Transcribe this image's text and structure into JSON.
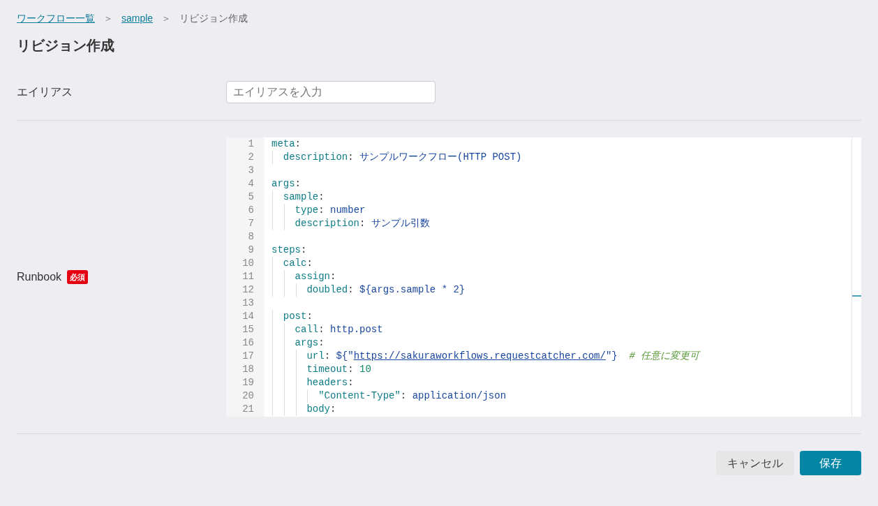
{
  "breadcrumb": [
    {
      "label": "ワークフロー一覧",
      "kind": "link"
    },
    {
      "label": "＞",
      "kind": "separator"
    },
    {
      "label": "sample",
      "kind": "link"
    },
    {
      "label": "＞",
      "kind": "separator"
    },
    {
      "label": "リビジョン作成",
      "kind": "current"
    }
  ],
  "title": "リビジョン作成",
  "alias": {
    "label": "エイリアス",
    "placeholder": "エイリアスを入力"
  },
  "runbook": {
    "label": "Runbook",
    "required_badge": "必須",
    "lines": [
      {
        "number": "1",
        "tokens": [
          {
            "kind": "key",
            "text": "meta"
          },
          {
            "kind": "punct",
            "text": ":"
          }
        ]
      },
      {
        "number": "2",
        "tokens": [
          {
            "kind": "key",
            "text": "  description"
          },
          {
            "kind": "punct",
            "text": ": "
          },
          {
            "kind": "value",
            "text": "サンプルワークフロー(HTTP POST)"
          }
        ]
      },
      {
        "number": "3"
      },
      {
        "number": "4",
        "tokens": [
          {
            "kind": "key",
            "text": "args"
          },
          {
            "kind": "punct",
            "text": ":"
          }
        ]
      },
      {
        "number": "5",
        "tokens": [
          {
            "kind": "key",
            "text": "  sample"
          },
          {
            "kind": "punct",
            "text": ":"
          }
        ]
      },
      {
        "number": "6",
        "tokens": [
          {
            "kind": "key",
            "text": "    type"
          },
          {
            "kind": "punct",
            "text": ": "
          },
          {
            "kind": "value",
            "text": "number"
          }
        ]
      },
      {
        "number": "7",
        "tokens": [
          {
            "kind": "key",
            "text": "    description"
          },
          {
            "kind": "punct",
            "text": ": "
          },
          {
            "kind": "value",
            "text": "サンプル引数"
          }
        ]
      },
      {
        "number": "8"
      },
      {
        "number": "9",
        "tokens": [
          {
            "kind": "key",
            "text": "steps"
          },
          {
            "kind": "punct",
            "text": ":"
          }
        ]
      },
      {
        "number": "10",
        "tokens": [
          {
            "kind": "key",
            "text": "  calc"
          },
          {
            "kind": "punct",
            "text": ":"
          }
        ]
      },
      {
        "number": "11",
        "tokens": [
          {
            "kind": "key",
            "text": "    assign"
          },
          {
            "kind": "punct",
            "text": ":"
          }
        ]
      },
      {
        "number": "12",
        "tokens": [
          {
            "kind": "key",
            "text": "      doubled"
          },
          {
            "kind": "punct",
            "text": ": "
          },
          {
            "kind": "value",
            "text": "${args.sample * 2}"
          }
        ]
      },
      {
        "number": "13"
      },
      {
        "number": "14",
        "tokens": [
          {
            "kind": "key",
            "text": "  post"
          },
          {
            "kind": "punct",
            "text": ":"
          }
        ]
      },
      {
        "number": "15",
        "tokens": [
          {
            "kind": "key",
            "text": "    call"
          },
          {
            "kind": "punct",
            "text": ": "
          },
          {
            "kind": "value",
            "text": "http.post"
          }
        ]
      },
      {
        "number": "16",
        "tokens": [
          {
            "kind": "key",
            "text": "    args"
          },
          {
            "kind": "punct",
            "text": ":"
          }
        ]
      },
      {
        "number": "17",
        "tokens": [
          {
            "kind": "key",
            "text": "      url"
          },
          {
            "kind": "punct",
            "text": ": "
          },
          {
            "kind": "value",
            "text": "${\""
          },
          {
            "kind": "link",
            "text": "https://sakuraworkflows.requestcatcher.com/"
          },
          {
            "kind": "value",
            "text": "\"}"
          },
          {
            "kind": "comment",
            "text": "  # 任意に変更可"
          }
        ]
      },
      {
        "number": "18",
        "tokens": [
          {
            "kind": "key",
            "text": "      timeout"
          },
          {
            "kind": "punct",
            "text": ": "
          },
          {
            "kind": "number",
            "text": "10"
          }
        ]
      },
      {
        "number": "19",
        "tokens": [
          {
            "kind": "key",
            "text": "      headers"
          },
          {
            "kind": "punct",
            "text": ":"
          }
        ]
      },
      {
        "number": "20",
        "tokens": [
          {
            "kind": "key",
            "text": "        \"Content-Type\""
          },
          {
            "kind": "punct",
            "text": ": "
          },
          {
            "kind": "value",
            "text": "application/json"
          }
        ]
      },
      {
        "number": "21",
        "tokens": [
          {
            "kind": "key",
            "text": "      body"
          },
          {
            "kind": "punct",
            "text": ":"
          }
        ]
      }
    ]
  },
  "buttons": [
    {
      "label": "キャンセル",
      "kind": "secondary"
    },
    {
      "label": "保存",
      "kind": "primary"
    }
  ]
}
